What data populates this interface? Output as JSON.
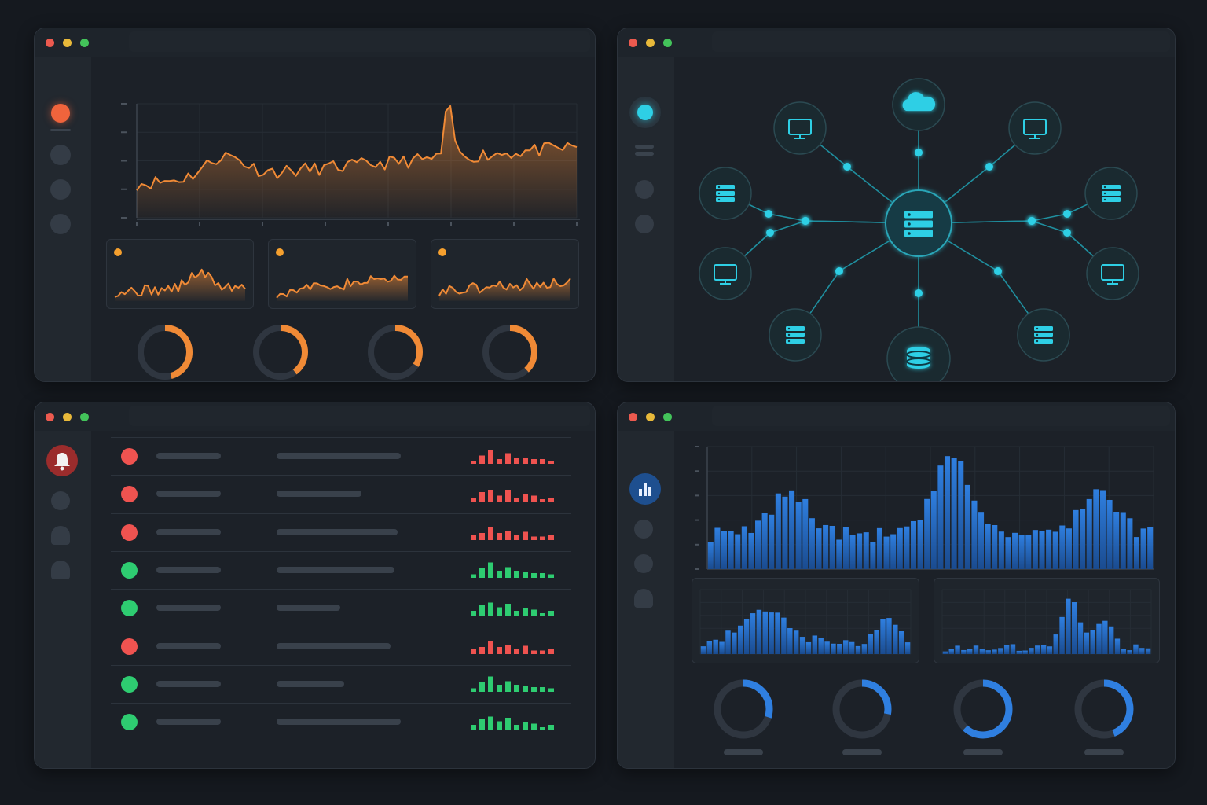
{
  "colors": {
    "orange": "#f08a36",
    "cyan": "#2ecfe5",
    "blue": "#2f7fe0",
    "red": "#ef5350",
    "green": "#2ecc71",
    "track": "#2f3640"
  },
  "windows": {
    "analytics": {
      "gauges": [
        0.46,
        0.4,
        0.34,
        0.38
      ]
    },
    "network": {
      "icons": [
        "cloud-icon",
        "monitor-icon",
        "monitor-icon",
        "server-icon",
        "server-icon",
        "monitor-icon",
        "monitor-icon",
        "server-icon",
        "server-icon",
        "database-icon",
        "server-icon"
      ]
    },
    "alerts": {
      "rows": [
        {
          "status": "red",
          "bar2": 0.72
        },
        {
          "status": "red",
          "bar2": 0.49
        },
        {
          "status": "red",
          "bar2": 0.7
        },
        {
          "status": "green",
          "bar2": 0.68
        },
        {
          "status": "green",
          "bar2": 0.37
        },
        {
          "status": "red",
          "bar2": 0.66
        },
        {
          "status": "green",
          "bar2": 0.39
        },
        {
          "status": "green",
          "bar2": 0.72
        }
      ],
      "spark_red": [
        3,
        7,
        11,
        5,
        9,
        4,
        6,
        4,
        3
      ],
      "spark_green": [
        4,
        8,
        12,
        7,
        9,
        5,
        6,
        4,
        3
      ]
    },
    "histogram": {
      "gauges": [
        0.3,
        0.28,
        0.62,
        0.44
      ]
    }
  }
}
